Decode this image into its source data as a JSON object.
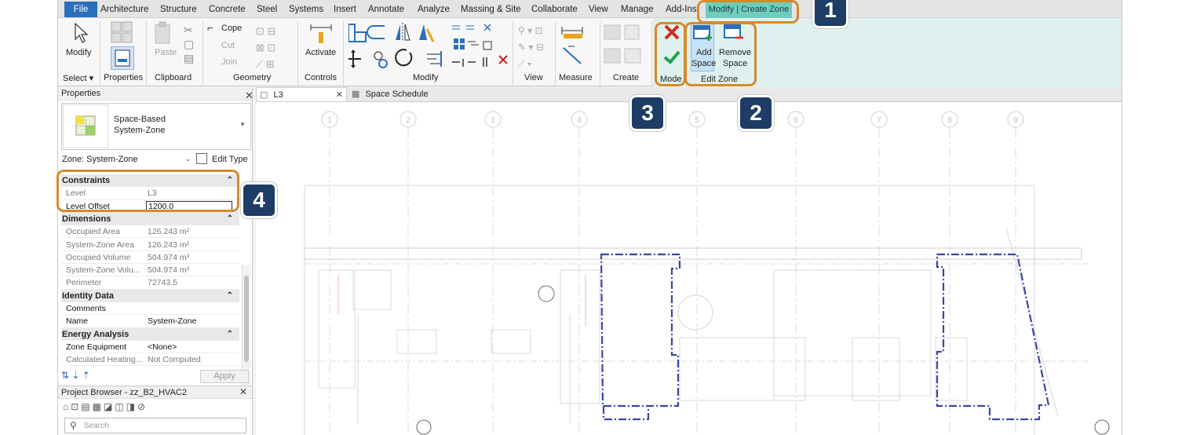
{
  "menu": {
    "file": "File",
    "tabs": [
      "Architecture",
      "Structure",
      "Concrete",
      "Steel",
      "Systems",
      "Insert",
      "Annotate",
      "Analyze",
      "Massing & Site",
      "Collaborate",
      "View",
      "Manage",
      "Add-Ins"
    ],
    "context_tab": "Modify | Create Zone"
  },
  "ribbon": {
    "modify": "Modify",
    "select": "Select ▾",
    "properties": "Properties",
    "clipboard": "Clipboard",
    "paste": "Paste",
    "cope": "Cope",
    "cut": "Cut",
    "join": "Join",
    "geometry": "Geometry",
    "activate": "Activate",
    "controls": "Controls",
    "modify_panel": "Modify",
    "view": "View",
    "measure": "Measure",
    "create": "Create",
    "mode": "Mode",
    "add_space_1": "Add",
    "add_space_2": "Space",
    "remove_space_1": "Remove",
    "remove_space_2": "Space",
    "edit_zone": "Edit Zone"
  },
  "properties": {
    "header": "Properties",
    "type_line1": "Space-Based",
    "type_line2": "System-Zone",
    "selector": "Zone: System-Zone",
    "edit_type": "Edit Type",
    "groups": [
      {
        "name": "Constraints",
        "rows": [
          {
            "k": "Level",
            "v": "L3",
            "active": false
          },
          {
            "k": "Level Offset",
            "v": "1200.0",
            "active": true
          }
        ]
      },
      {
        "name": "Dimensions",
        "rows": [
          {
            "k": "Occupied Area",
            "v": "126.243 m²",
            "active": false
          },
          {
            "k": "System-Zone Area",
            "v": "126.243 m²",
            "active": false
          },
          {
            "k": "Occupied Volume",
            "v": "504.974 m³",
            "active": false
          },
          {
            "k": "System-Zone Volu...",
            "v": "504.974 m³",
            "active": false
          },
          {
            "k": "Perimeter",
            "v": "72743.5",
            "active": false
          }
        ]
      },
      {
        "name": "Identity Data",
        "rows": [
          {
            "k": "Comments",
            "v": "",
            "active": true
          },
          {
            "k": "Name",
            "v": "System-Zone",
            "active": true
          }
        ]
      },
      {
        "name": "Energy Analysis",
        "rows": [
          {
            "k": "Zone Equipment",
            "v": "<None>",
            "active": true
          },
          {
            "k": "Calculated Heating...",
            "v": "Not Computed",
            "active": false
          }
        ]
      }
    ],
    "apply": "Apply"
  },
  "browser": {
    "title": "Project Browser - zz_B2_HVAC2",
    "search_placeholder": "Search"
  },
  "view": {
    "tabs": [
      "L3",
      "Space Schedule"
    ],
    "grid_labels": [
      "1",
      "2",
      "3",
      "4",
      "5",
      "6",
      "7",
      "8",
      "9"
    ]
  },
  "callouts": [
    "1",
    "2",
    "3",
    "4"
  ],
  "colors": {
    "file_tab": "#2a6fbb",
    "context_tab": "#6fcdbf",
    "callout_border": "#d68a2a",
    "badge_bg": "#1d3c66",
    "zone_boundary": "#3a45a8"
  }
}
